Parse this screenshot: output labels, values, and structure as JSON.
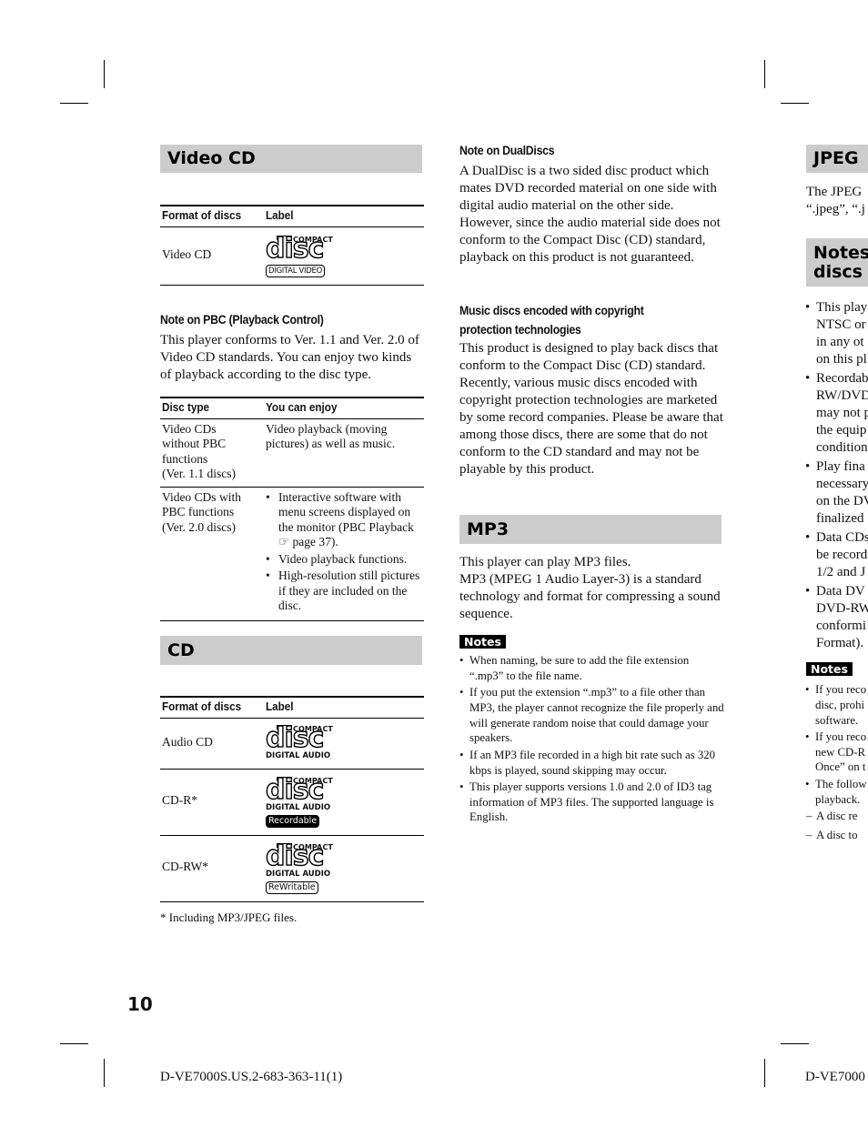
{
  "page_number": "10",
  "footer": {
    "left_code": "D-VE7000S.US.2-683-363-11(1)",
    "right_code": "D-VE7000"
  },
  "video_cd": {
    "title": "Video CD",
    "table": {
      "headers": [
        "Format of discs",
        "Label"
      ],
      "rows": [
        {
          "format": "Video CD",
          "logo": {
            "top": "COMPACT",
            "mark": "disc",
            "bottom": "DIGITAL VIDEO",
            "badge": ""
          }
        }
      ]
    },
    "pbc_note": {
      "heading": "Note on PBC (Playback Control)",
      "text": "This player conforms to Ver. 1.1 and Ver. 2.0 of Video CD standards. You can enjoy two kinds of playback according to the disc type."
    },
    "pbc_table": {
      "headers": [
        "Disc type",
        "You can enjoy"
      ],
      "rows": [
        {
          "type": [
            "Video CDs",
            "without PBC",
            "functions",
            "(Ver. 1.1 discs)"
          ],
          "enjoy_text": "Video playback (moving pictures) as well as music."
        },
        {
          "type": [
            "Video CDs with",
            "PBC functions",
            "(Ver. 2.0 discs)"
          ],
          "enjoy_items": [
            "Interactive software with menu screens displayed on the monitor (PBC Playback",
            "Video playback functions.",
            "High-resolution still pictures if they are included on the disc."
          ],
          "ref_icon": "pointing-hand-icon",
          "ref_glyph": "☞",
          "ref_text": "page 37)."
        }
      ]
    }
  },
  "cd": {
    "title": "CD",
    "table": {
      "headers": [
        "Format of discs",
        "Label"
      ],
      "rows": [
        {
          "format": "Audio CD",
          "logo": {
            "top": "COMPACT",
            "mark": "disc",
            "bottom": "DIGITAL AUDIO",
            "badge": ""
          }
        },
        {
          "format": "CD-R*",
          "logo": {
            "top": "COMPACT",
            "mark": "disc",
            "bottom": "DIGITAL AUDIO",
            "badge": "Recordable"
          }
        },
        {
          "format": "CD-RW*",
          "logo": {
            "top": "COMPACT",
            "mark": "disc",
            "bottom": "DIGITAL AUDIO",
            "badge": "ReWritable"
          }
        }
      ]
    },
    "footnote": "* Including MP3/JPEG files."
  },
  "dualdisc": {
    "heading": "Note on DualDiscs",
    "text": "A DualDisc is a two sided disc product which mates DVD recorded material on one side with digital audio material on the other side.  However, since the audio material side does not conform to the Compact Disc (CD) standard, playback on this product is not guaranteed."
  },
  "copyright": {
    "heading_line1": "Music discs encoded with copyright",
    "heading_line2": "protection technologies",
    "text": "This product is designed to play back discs that conform to the Compact Disc (CD) standard.  Recently, various music discs encoded with copyright protection technologies are marketed by some record companies.  Please be aware that among those discs, there are some that do not conform to the CD standard and may not be playable by this product."
  },
  "mp3": {
    "title": "MP3",
    "line1": "This player can play MP3 files.",
    "line2": "MP3 (MPEG 1 Audio Layer-3) is a standard technology and format for compressing a sound sequence.",
    "notes_label": "Notes",
    "notes": [
      "When naming, be sure to add the file extension “.mp3” to the file name.",
      "If you put the extension “.mp3” to a file other than MP3, the player cannot recognize the file properly and will generate random noise that could damage your speakers.",
      "If an MP3 file recorded in a high bit rate such as 320 kbps is played, sound skipping may occur.",
      "This player supports versions 1.0 and 2.0 of ID3 tag information of MP3 files. The supported language is English."
    ]
  },
  "right_column": {
    "jpeg_title": "JPEG",
    "jpeg_lines": [
      "The JPEG",
      "“.jpeg”, “.j"
    ],
    "notes_discs_title_line1": "Notes",
    "notes_discs_title_line2": "discs",
    "bullets": [
      [
        "This play",
        "NTSC or",
        "in any ot",
        "on this pl"
      ],
      [
        "Recordab",
        "RW/DVD",
        "may not p",
        "the equip",
        "condition"
      ],
      [
        "Play fina",
        "necessary",
        "on the DV",
        "finalized"
      ],
      [
        "Data CDs",
        "be record",
        "1/2 and J"
      ],
      [
        "Data DV",
        "DVD-RW",
        "conformi",
        "Format)."
      ]
    ],
    "notes_label": "Notes",
    "notes": [
      [
        "If you reco",
        "disc, prohi",
        "software."
      ],
      [
        "If you reco",
        "new CD-R",
        "Once” on t"
      ],
      [
        "The follow",
        "playback."
      ]
    ],
    "dash_items": [
      "A disc re",
      "A disc to"
    ]
  }
}
